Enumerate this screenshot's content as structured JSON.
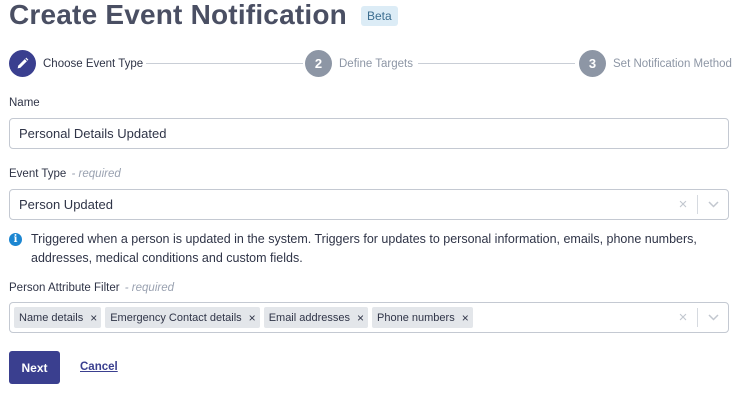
{
  "header": {
    "title": "Create Event Notification",
    "badge": "Beta"
  },
  "stepper": {
    "steps": [
      {
        "number": "",
        "label": "Choose Event Type",
        "state": "active",
        "icon": "pencil-icon"
      },
      {
        "number": "2",
        "label": "Define Targets",
        "state": "inactive"
      },
      {
        "number": "3",
        "label": "Set Notification Method",
        "state": "inactive"
      }
    ]
  },
  "form": {
    "name": {
      "label": "Name",
      "value": "Personal Details Updated"
    },
    "event_type": {
      "label": "Event Type",
      "required_hint": "- required",
      "value": "Person Updated"
    },
    "info": {
      "icon": "info-icon",
      "text": "Triggered when a person is updated in the system. Triggers for updates to personal information, emails, phone numbers, addresses, medical conditions and custom fields."
    },
    "attribute_filter": {
      "label": "Person Attribute Filter",
      "required_hint": "- required",
      "tags": [
        "Name details",
        "Emergency Contact details",
        "Email addresses",
        "Phone numbers"
      ]
    }
  },
  "actions": {
    "next_label": "Next",
    "cancel_label": "Cancel"
  },
  "colors": {
    "primary": "#3a3f8f",
    "inactive_step": "#8d96a5",
    "info": "#1c86d1",
    "badge_bg": "#dcecf6"
  }
}
